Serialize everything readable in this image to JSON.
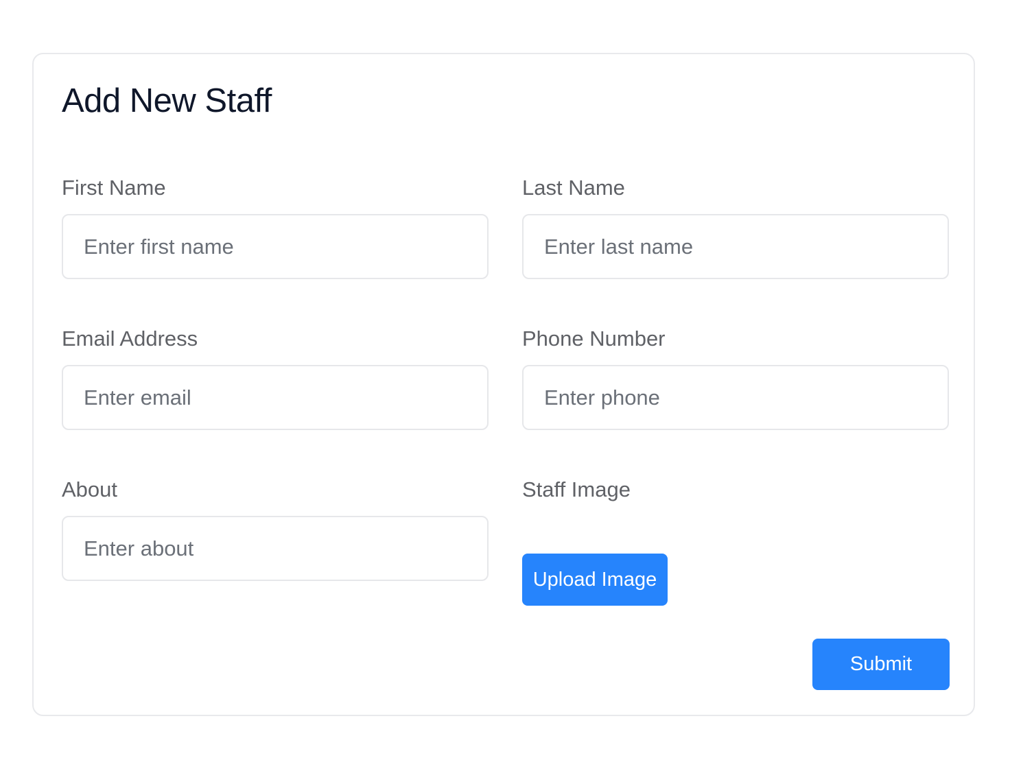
{
  "form": {
    "title": "Add New Staff",
    "fields": {
      "first_name": {
        "label": "First Name",
        "placeholder": "Enter first name",
        "value": ""
      },
      "last_name": {
        "label": "Last Name",
        "placeholder": "Enter last name",
        "value": ""
      },
      "email": {
        "label": "Email Address",
        "placeholder": "Enter email",
        "value": ""
      },
      "phone": {
        "label": "Phone Number",
        "placeholder": "Enter phone",
        "value": ""
      },
      "about": {
        "label": "About",
        "placeholder": "Enter about",
        "value": ""
      },
      "image": {
        "label": "Staff Image",
        "button_label": "Upload Image"
      }
    },
    "submit_label": "Submit"
  },
  "colors": {
    "accent": "#2684fc",
    "title_text": "#0f172a",
    "label_text": "#5f6166",
    "placeholder_text": "#6b7078",
    "border": "#e6e7ea"
  }
}
